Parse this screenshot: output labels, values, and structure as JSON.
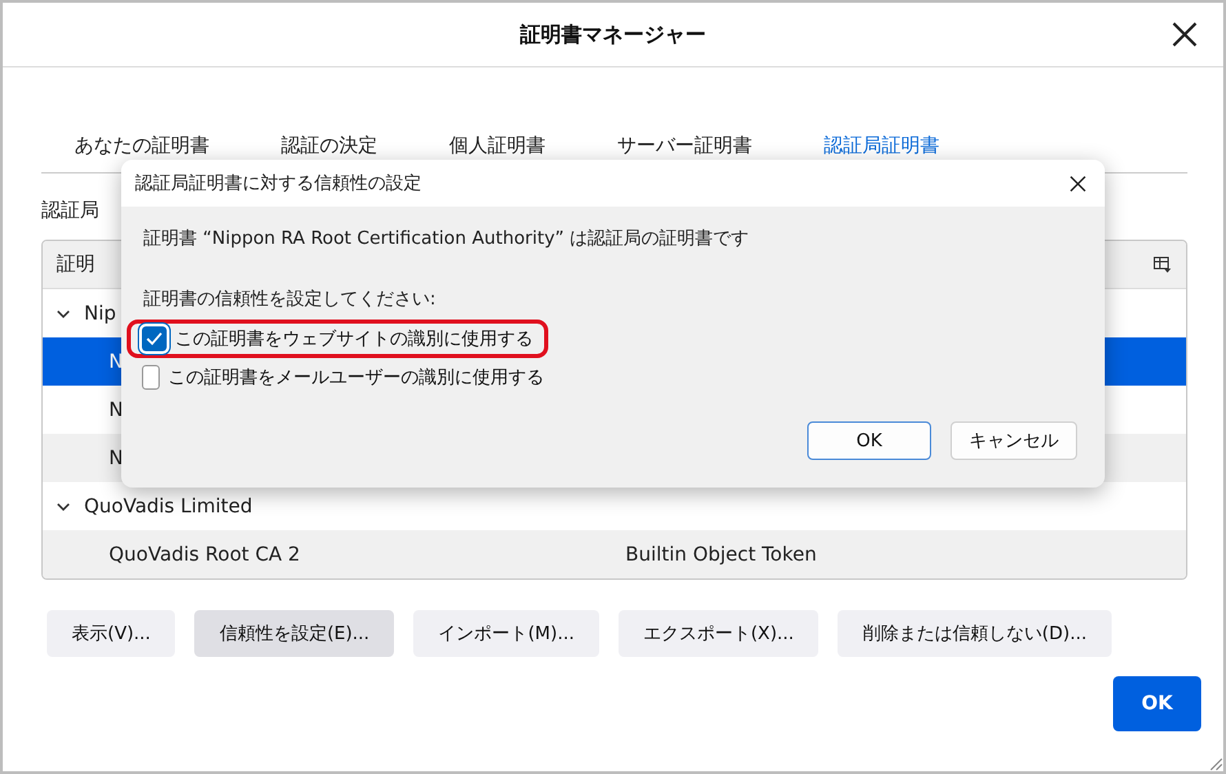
{
  "window": {
    "title": "証明書マネージャー"
  },
  "tabs": [
    {
      "label": "あなたの証明書",
      "selected": false
    },
    {
      "label": "認証の決定",
      "selected": false
    },
    {
      "label": "個人証明書",
      "selected": false
    },
    {
      "label": "サーバー証明書",
      "selected": false
    },
    {
      "label": "認証局証明書",
      "selected": true
    }
  ],
  "intro_text": "認証局",
  "table": {
    "columns": [
      "証明"
    ],
    "groups": [
      {
        "name": "Nip",
        "expanded": true,
        "rows": [
          {
            "cells": [
              "N"
            ],
            "selected": true
          },
          {
            "cells": [
              "N"
            ],
            "selected": false
          },
          {
            "cells": [
              "N"
            ],
            "selected": false
          }
        ]
      },
      {
        "name": "QuoVadis Limited",
        "expanded": true,
        "rows": [
          {
            "cells": [
              "QuoVadis Root CA 2",
              "Builtin Object Token"
            ],
            "selected": false
          }
        ]
      }
    ]
  },
  "buttons": [
    {
      "label": "表示(V)...",
      "pressed": false
    },
    {
      "label": "信頼性を設定(E)...",
      "pressed": true
    },
    {
      "label": "インポート(M)...",
      "pressed": false
    },
    {
      "label": "エクスポート(X)...",
      "pressed": false
    },
    {
      "label": "削除または信頼しない(D)...",
      "pressed": false
    }
  ],
  "ok_button": "OK",
  "dialog": {
    "title": "認証局証明書に対する信頼性の設定",
    "message": "証明書 “Nippon RA Root Certification Authority” は認証局の証明書です",
    "prompt": "証明書の信頼性を設定してください:",
    "options": [
      {
        "label": "この証明書をウェブサイトの識別に使用する",
        "checked": true,
        "highlighted": true
      },
      {
        "label": "この証明書をメールユーザーの識別に使用する",
        "checked": false,
        "highlighted": false
      }
    ],
    "buttons": [
      {
        "label": "OK",
        "default": true
      },
      {
        "label": "キャンセル",
        "default": false
      }
    ]
  }
}
